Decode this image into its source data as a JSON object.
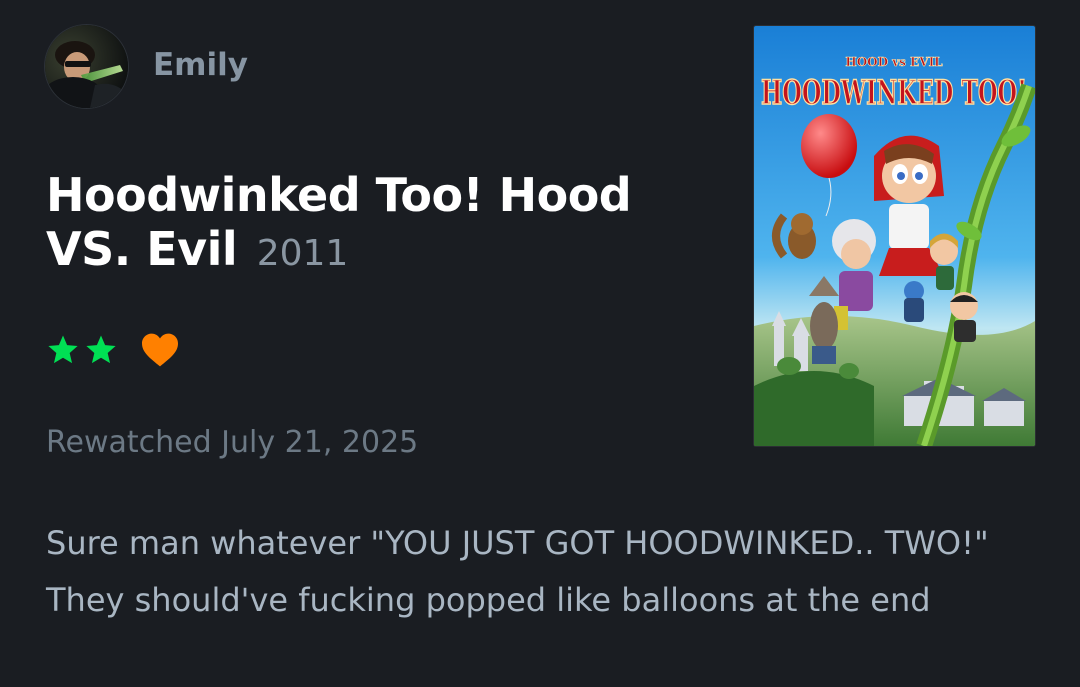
{
  "review": {
    "user": {
      "name": "Emily",
      "avatar_icon": "user-avatar-photo"
    },
    "film": {
      "title": "Hoodwinked Too! Hood VS. Evil",
      "year": "2011",
      "poster": {
        "top_text": "HOOD vs EVIL",
        "main_text": "HOODWINKED TOO!"
      }
    },
    "rating": {
      "stars": 2,
      "max_stars": 5,
      "star_color": "#00e054",
      "liked": true,
      "heart_color": "#ff8000"
    },
    "watched_text": "Rewatched July 21, 2025",
    "body": "Sure man whatever \"YOU JUST GOT HOODWINKED.. TWO!\" They should've fucking popped like balloons at the end"
  }
}
